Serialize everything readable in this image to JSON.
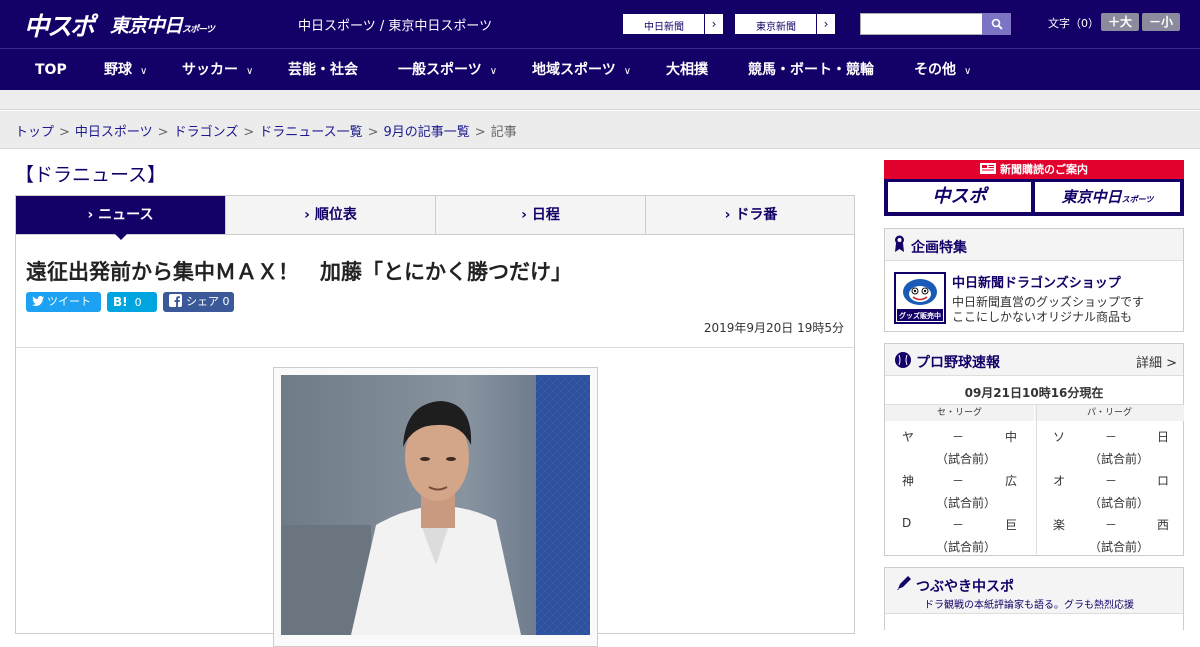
{
  "header": {
    "logo_chuspo": "中スポ",
    "logo_tokyo": "東京中日",
    "logo_tokyo_small": "スポーツ",
    "title": "中日スポーツ / 東京中日スポーツ",
    "paper_links": [
      {
        "label": "中日新聞",
        "arrow": "›"
      },
      {
        "label": "東京新聞",
        "arrow": "›"
      }
    ],
    "search_placeholder": "",
    "font_size_label": "文字（0）",
    "font_larger": "＋大",
    "font_smaller": "－小"
  },
  "nav": {
    "items": [
      {
        "label": "TOP",
        "dropdown": false
      },
      {
        "label": "野球",
        "dropdown": true
      },
      {
        "label": "サッカー",
        "dropdown": true
      },
      {
        "label": "芸能・社会",
        "dropdown": false
      },
      {
        "label": "一般スポーツ",
        "dropdown": true
      },
      {
        "label": "地域スポーツ",
        "dropdown": true
      },
      {
        "label": "大相撲",
        "dropdown": false
      },
      {
        "label": "競馬・ボート・競輪",
        "dropdown": false
      },
      {
        "label": "その他",
        "dropdown": true
      }
    ],
    "chevron": "∨"
  },
  "breadcrumb": {
    "links": [
      "トップ",
      "中日スポーツ",
      "ドラゴンズ",
      "ドラニュース一覧",
      "9月の記事一覧"
    ],
    "current": "記事",
    "separator": ">"
  },
  "section_title": "【ドラニュース】",
  "tabs": [
    {
      "label": "ニュース",
      "active": true
    },
    {
      "label": "順位表",
      "active": false
    },
    {
      "label": "日程",
      "active": false
    },
    {
      "label": "ドラ番",
      "active": false
    }
  ],
  "tab_prefix": "›",
  "article": {
    "headline": "遠征出発前から集中ＭＡＸ！　加藤「とにかく勝つだけ」",
    "share": {
      "tweet_label": "ツイート",
      "hatena_label": "B!",
      "hatena_count": "0",
      "facebook_label": "シェア",
      "facebook_count": "0"
    },
    "date": "2019年9月20日 19時5分"
  },
  "sidebar": {
    "subscribe_banner": {
      "title": "新聞購読のご案内",
      "logo_chuspo": "中スポ",
      "logo_tokyo": "東京中日",
      "logo_tokyo_small": "スポーツ"
    },
    "feature": {
      "title": "企画特集",
      "shop_thumb_label": "グッズ販売中",
      "shop_name": "中日新聞ドラゴンズショップ",
      "shop_desc_1": "中日新聞直営のグッズショップです",
      "shop_desc_2": "ここにしかないオリジナル商品も"
    },
    "scores": {
      "title": "プロ野球速報",
      "more": "詳細 >",
      "as_of": "09月21日10時16分現在",
      "central_label": "セ・リーグ",
      "pacific_label": "パ・リーグ",
      "central": [
        {
          "home": "ヤ",
          "vs": "－",
          "away": "中",
          "status": "（試合前）"
        },
        {
          "home": "神",
          "vs": "－",
          "away": "広",
          "status": "（試合前）"
        },
        {
          "home": "D",
          "vs": "－",
          "away": "巨",
          "status": "（試合前）"
        }
      ],
      "pacific": [
        {
          "home": "ソ",
          "vs": "－",
          "away": "日",
          "status": "（試合前）"
        },
        {
          "home": "オ",
          "vs": "－",
          "away": "ロ",
          "status": "（試合前）"
        },
        {
          "home": "楽",
          "vs": "－",
          "away": "西",
          "status": "（試合前）"
        }
      ]
    },
    "tweets": {
      "title": "つぶやき中スポ",
      "subtitle": "ドラ観戦の本紙評論家も語る。グラも熱烈応援"
    }
  },
  "colors": {
    "brand_navy": "#150068",
    "subscribe_red": "#e2002d",
    "twitter_blue": "#1da1f2",
    "hatena_blue": "#00a4de",
    "facebook_blue": "#3b5998"
  }
}
